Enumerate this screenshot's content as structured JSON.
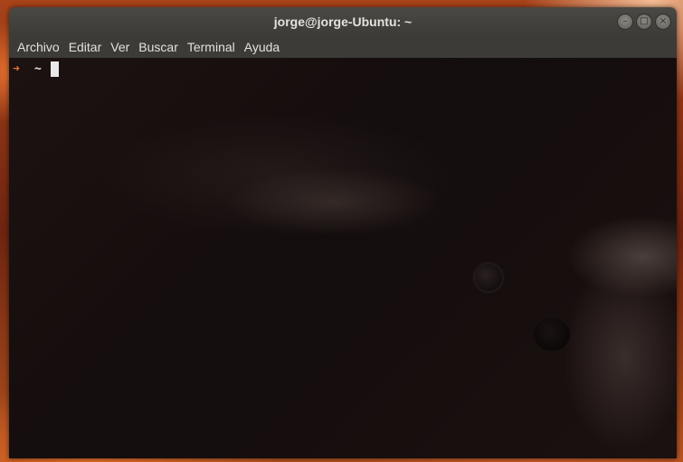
{
  "window": {
    "title": "jorge@jorge-Ubuntu: ~",
    "controls": [
      "minimize-icon",
      "maximize-icon",
      "close-icon"
    ]
  },
  "menubar": {
    "items": [
      "Archivo",
      "Editar",
      "Ver",
      "Buscar",
      "Terminal",
      "Ayuda"
    ]
  },
  "terminal": {
    "prompt_symbol": "➜",
    "current_dir": "~",
    "prompt_color": "#e8743b"
  }
}
